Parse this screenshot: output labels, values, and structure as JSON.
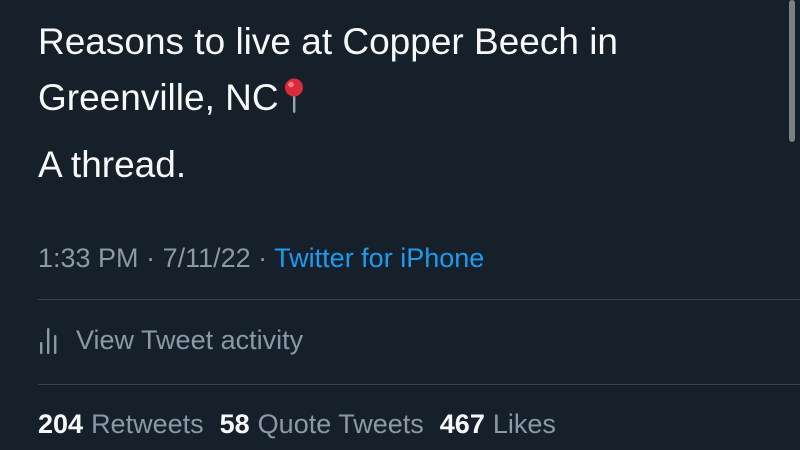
{
  "tweet": {
    "text_line1": "Reasons to live at Copper Beech in",
    "text_line2": "Greenville, NC",
    "text_line3": "A thread.",
    "pin_icon": "round-pushpin-icon"
  },
  "meta": {
    "time": "1:33 PM",
    "sep1": " · ",
    "date": "7/11/22",
    "sep2": " · ",
    "source": "Twitter for iPhone"
  },
  "activity": {
    "icon": "bar-chart-icon",
    "label": "View Tweet activity"
  },
  "stats": {
    "retweets_count": "204",
    "retweets_label": "Retweets",
    "quotes_count": "58",
    "quotes_label": "Quote Tweets",
    "likes_count": "467",
    "likes_label": "Likes"
  },
  "colors": {
    "background": "#15202b",
    "text_primary": "#f7f9f9",
    "text_secondary": "#8b98a5",
    "link": "#1d9bf0",
    "divider": "#38444d"
  }
}
